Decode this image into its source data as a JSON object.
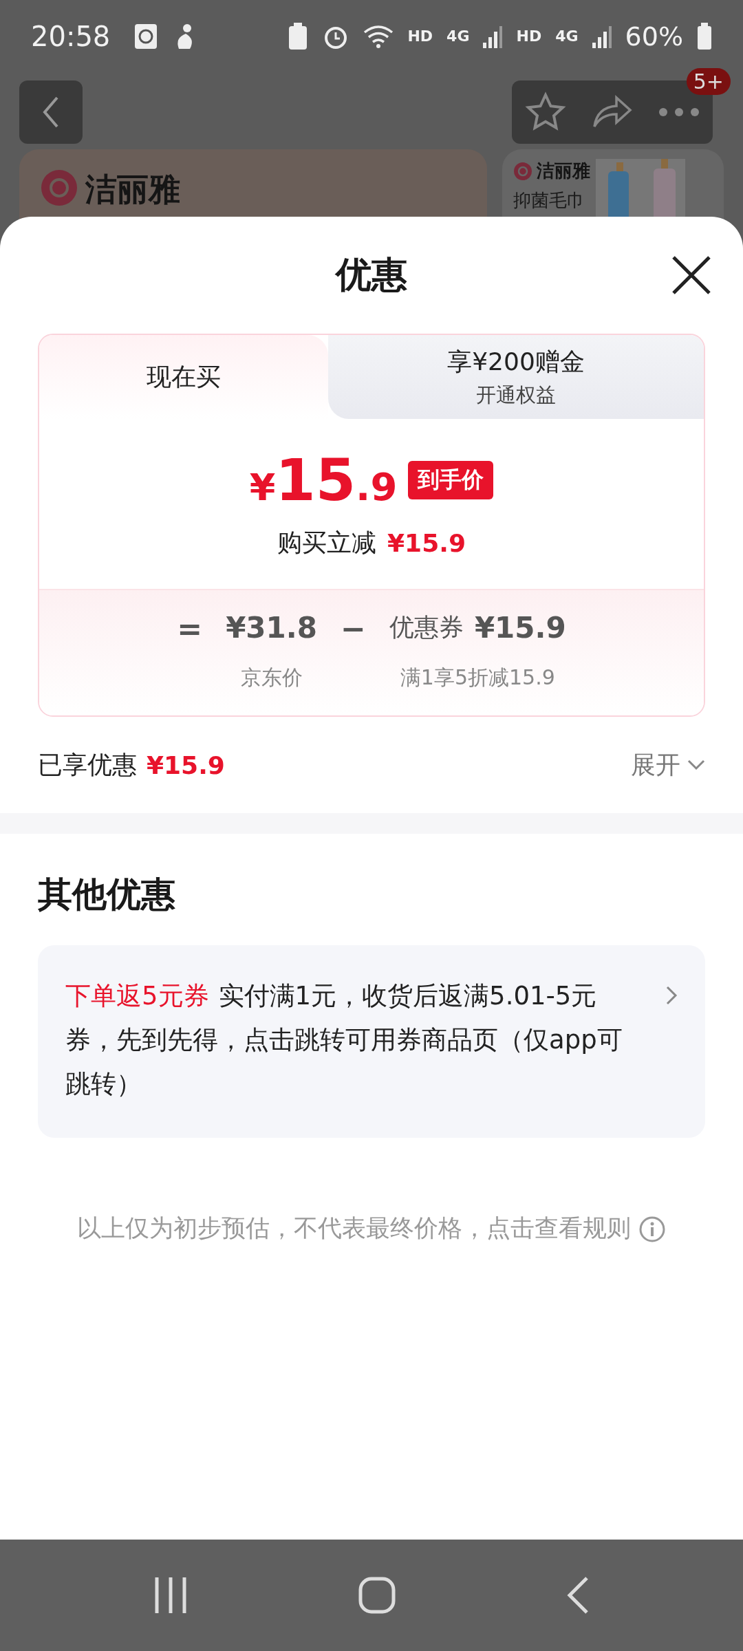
{
  "status_bar": {
    "time": "20:58",
    "network": [
      "HD",
      "4G",
      "HD",
      "4G"
    ],
    "battery": "60%"
  },
  "background": {
    "badge": "5+",
    "cards": [
      {
        "brand": "洁丽雅"
      },
      {
        "brand": "洁丽雅",
        "title": "抑菌毛巾"
      }
    ]
  },
  "sheet": {
    "title": "优惠",
    "tabs": [
      {
        "label": "现在买",
        "selected": true
      },
      {
        "label": "享¥200赠金",
        "sublabel": "开通权益",
        "selected": false
      }
    ],
    "price": {
      "currency": "¥",
      "integer": "15",
      "decimal": ".9",
      "tag": "到手价"
    },
    "reduction": {
      "label": "购买立减",
      "value": "¥15.9"
    },
    "formula": {
      "equals": "=",
      "minus": "−",
      "base": {
        "value": "¥31.8",
        "caption": "京东价"
      },
      "coupon": {
        "label": "优惠券",
        "value": "¥15.9",
        "caption": "满1享5折减15.9"
      }
    },
    "summary": {
      "label": "已享优惠",
      "value": "¥15.9",
      "toggle": "展开"
    },
    "other": {
      "title": "其他优惠",
      "offers": [
        {
          "tag": "下单返5元券",
          "text": "实付满1元，收货后返满5.01-5元券，先到先得，点击跳转可用券商品页（仅app可跳转）"
        }
      ]
    },
    "note": "以上仅为初步预估，不代表最终价格，点击查看规则"
  }
}
